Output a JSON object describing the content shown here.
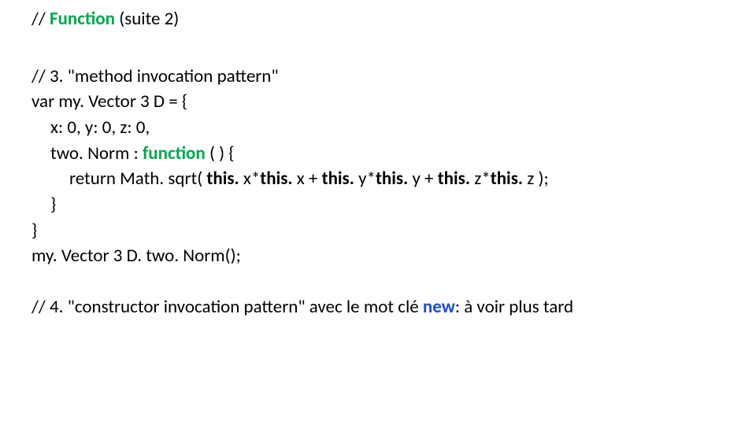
{
  "title": {
    "prefix": "// ",
    "keyword": "Function ",
    "suffix": "(suite 2)"
  },
  "section3": {
    "l1": "// 3. \"method invocation pattern\"",
    "l2": "var my. Vector 3 D = {",
    "l3": "x: 0, y: 0, z: 0,",
    "l4_a": "two. Norm : ",
    "l4_b": "function ",
    "l4_c": "( ) {",
    "l5_a": "return Math. sqrt( ",
    "l5_b": "this. ",
    "l5_c": "x*",
    "l5_d": "this. ",
    "l5_e": "x + ",
    "l5_f": "this. ",
    "l5_g": "y*",
    "l5_h": "this. ",
    "l5_i": "y + ",
    "l5_j": "this. ",
    "l5_k": "z*",
    "l5_l": "this. ",
    "l5_m": "z );",
    "l6": "}",
    "l7": "}",
    "l8": "my. Vector 3 D. two. Norm();"
  },
  "section4": {
    "a": "// 4. \"constructor invocation pattern\" avec le mot clé ",
    "b": "new",
    "c": ": à voir plus tard"
  }
}
